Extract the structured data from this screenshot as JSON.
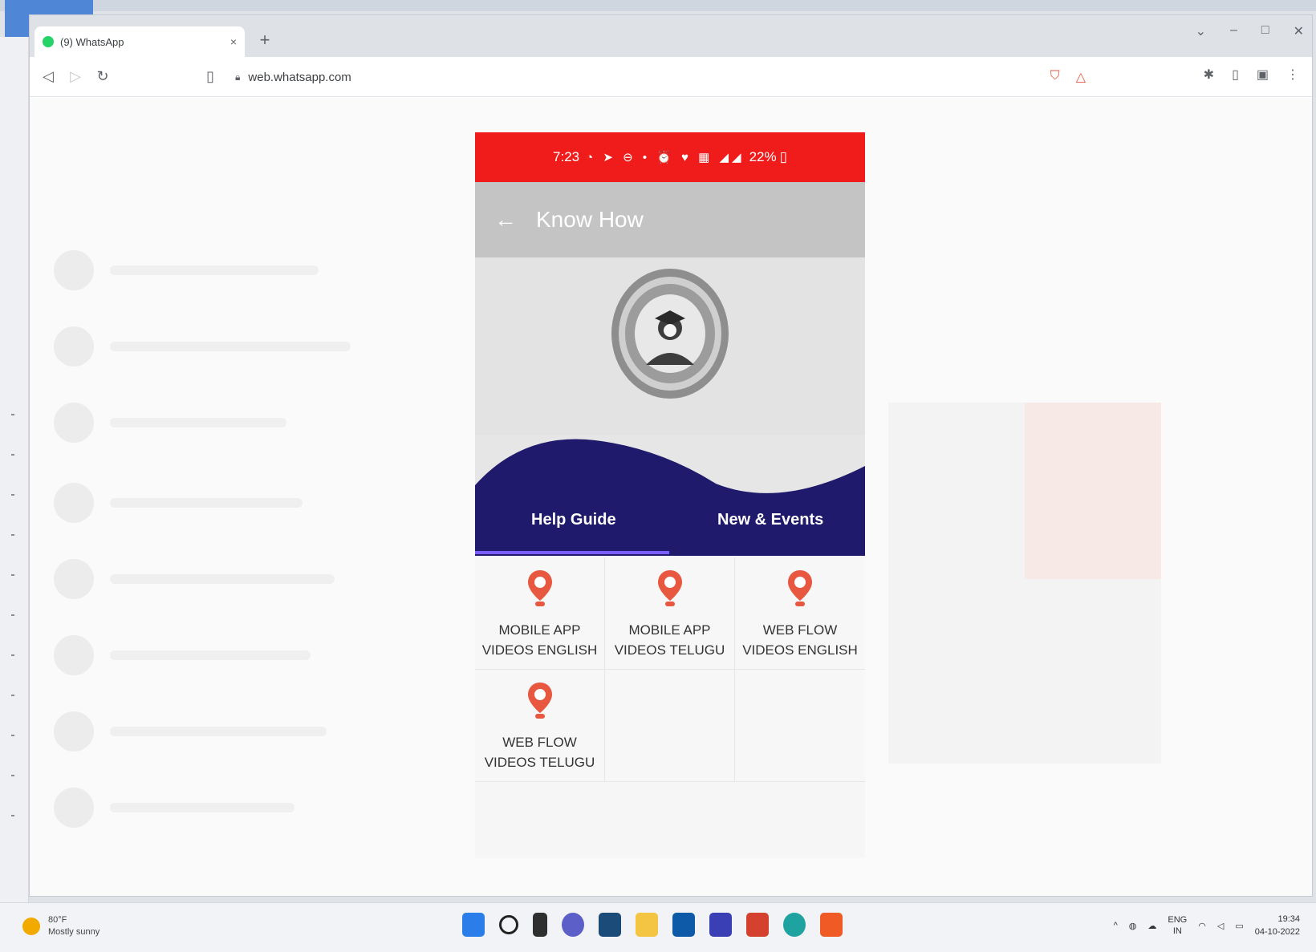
{
  "browser": {
    "tab_title": "(9) WhatsApp",
    "tab_close": "×",
    "new_tab": "+",
    "url": "web.whatsapp.com",
    "window_controls": [
      "⌄",
      "–",
      "□",
      "✕"
    ]
  },
  "phone": {
    "status_time": "7:23",
    "status_icons": "◔ ➤ ⊖ • ⏰ ♥ ▦ ◢◢",
    "battery": "22%",
    "app_title": "Know How",
    "tabs": [
      {
        "label": "Help Guide",
        "active": true
      },
      {
        "label": "New & Events",
        "active": false
      }
    ],
    "items": [
      {
        "line1": "MOBILE APP",
        "line2": "VIDEOS ENGLISH"
      },
      {
        "line1": "MOBILE APP",
        "line2": "VIDEOS TELUGU"
      },
      {
        "line1": "WEB FLOW",
        "line2": "VIDEOS ENGLISH"
      },
      {
        "line1": "WEB FLOW",
        "line2": "VIDEOS TELUGU"
      }
    ],
    "colors": {
      "status_bar": "#f01c1c",
      "app_bar": "#c4c4c4",
      "wave": "#1f1a6b",
      "indicator": "#7b5cff",
      "pin": "#e8573f"
    }
  },
  "taskbar": {
    "weather_temp": "80°F",
    "weather_desc": "Mostly sunny",
    "lang_top": "ENG",
    "lang_bottom": "IN",
    "time": "19:34",
    "date": "04-10-2022"
  }
}
